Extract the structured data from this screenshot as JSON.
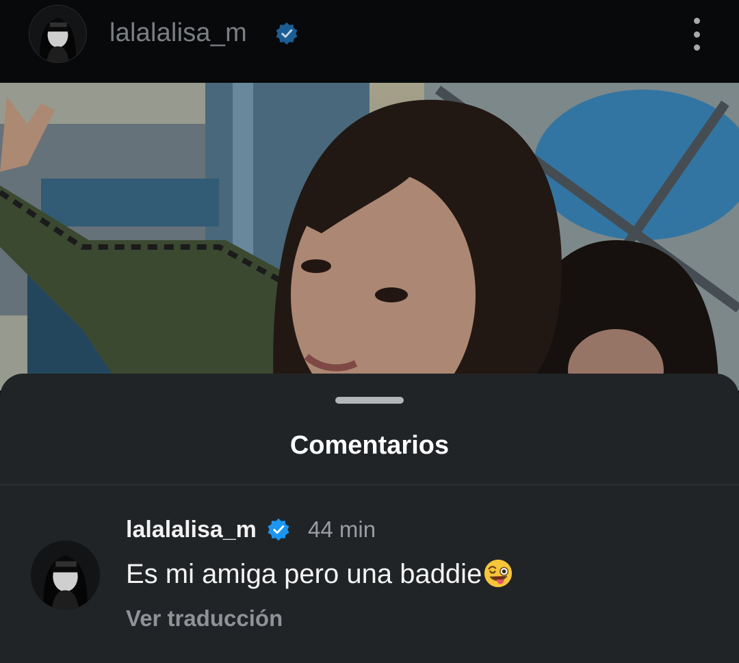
{
  "header": {
    "username": "lalalalisa_m",
    "verified_icon": "verified-badge-icon",
    "more_icon": "more-vertical-icon"
  },
  "post": {
    "image": "photo of two girls posing close to the camera"
  },
  "comments_sheet": {
    "title": "Comentarios",
    "comments": [
      {
        "username": "lalalalisa_m",
        "verified": true,
        "time": "44 min",
        "text": "Es mi amiga pero una baddie",
        "emoji": "winking-face-with-tongue",
        "translate_label": "Ver traducción"
      }
    ]
  },
  "colors": {
    "background": "#050608",
    "sheet": "#212427",
    "verified_blue": "#1c96f0",
    "secondary_text": "#9a9da2"
  }
}
